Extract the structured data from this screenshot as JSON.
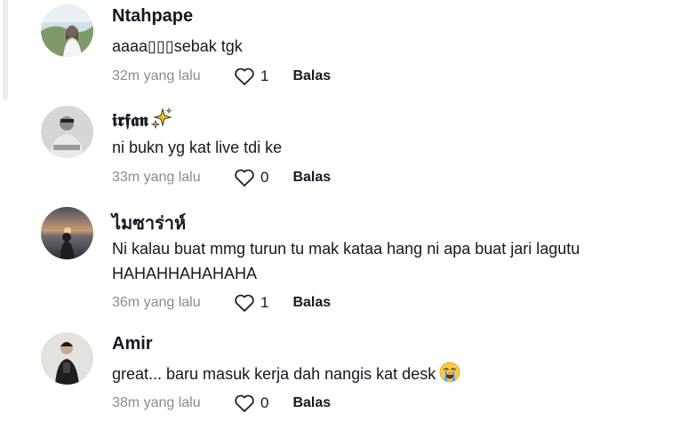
{
  "comments": [
    {
      "username": "Ntahpape",
      "text": "aaaa▯▯▯sebak tgk",
      "time": "32m yang lalu",
      "likes": "1",
      "reply_label": "Balas"
    },
    {
      "username": "𝖎𝖗𝖋𝖆𝖓",
      "text": "ni bukn yg kat live tdi ke",
      "time": "33m yang lalu",
      "likes": "0",
      "reply_label": "Balas"
    },
    {
      "username": "ไมซาร่าห์",
      "text": "Ni kalau buat mmg turun tu mak kataa hang ni apa buat jari lagutu HAHAHHAHAHAHA",
      "time": "36m yang lalu",
      "likes": "1",
      "reply_label": "Balas"
    },
    {
      "username": "Amir",
      "text": "great... baru masuk kerja dah nangis kat desk",
      "time": "38m yang lalu",
      "likes": "0",
      "reply_label": "Balas"
    }
  ],
  "icons": {
    "like": "heart-outline-icon",
    "sparkle": "sparkles-icon",
    "crying_face": "loudly-crying-face-icon"
  },
  "colors": {
    "text_primary": "#161823",
    "text_secondary": "#8a8b91",
    "sparkle_yellow": "#f5c518"
  }
}
